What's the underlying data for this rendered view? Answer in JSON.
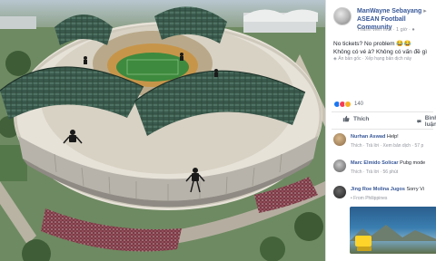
{
  "post": {
    "author": "ManWayne Sebayang",
    "group": "ASEAN Football Community",
    "meta": "Thành viên mới · 1 giờ · ",
    "text_line1": "No tickets? No problem 😂😂",
    "text_line2": "Không có vé à? Không có vấn đề gì",
    "translate": "Ẩn bản gốc · Xếp hạng bản dịch này"
  },
  "reactions": {
    "count": "140"
  },
  "actions": {
    "like": "Thích",
    "comment": "Bình luận"
  },
  "comments": [
    {
      "name": "Nurhan Aswad",
      "text": "Help!",
      "meta": "Thích · Trả lời · Xem bản dịch · 57 p"
    },
    {
      "name": "Marc Elmido Solicar",
      "text": "Pubg mode",
      "meta": "Thích · Trả lời · 56 phút"
    },
    {
      "name": "Jing Roe Molina Jugos",
      "text": "Sorry Vi",
      "meta": "From Philippines"
    }
  ],
  "colors": {
    "link": "#385898",
    "like": "#1877f2",
    "love": "#f33e58",
    "haha": "#f7b125"
  }
}
